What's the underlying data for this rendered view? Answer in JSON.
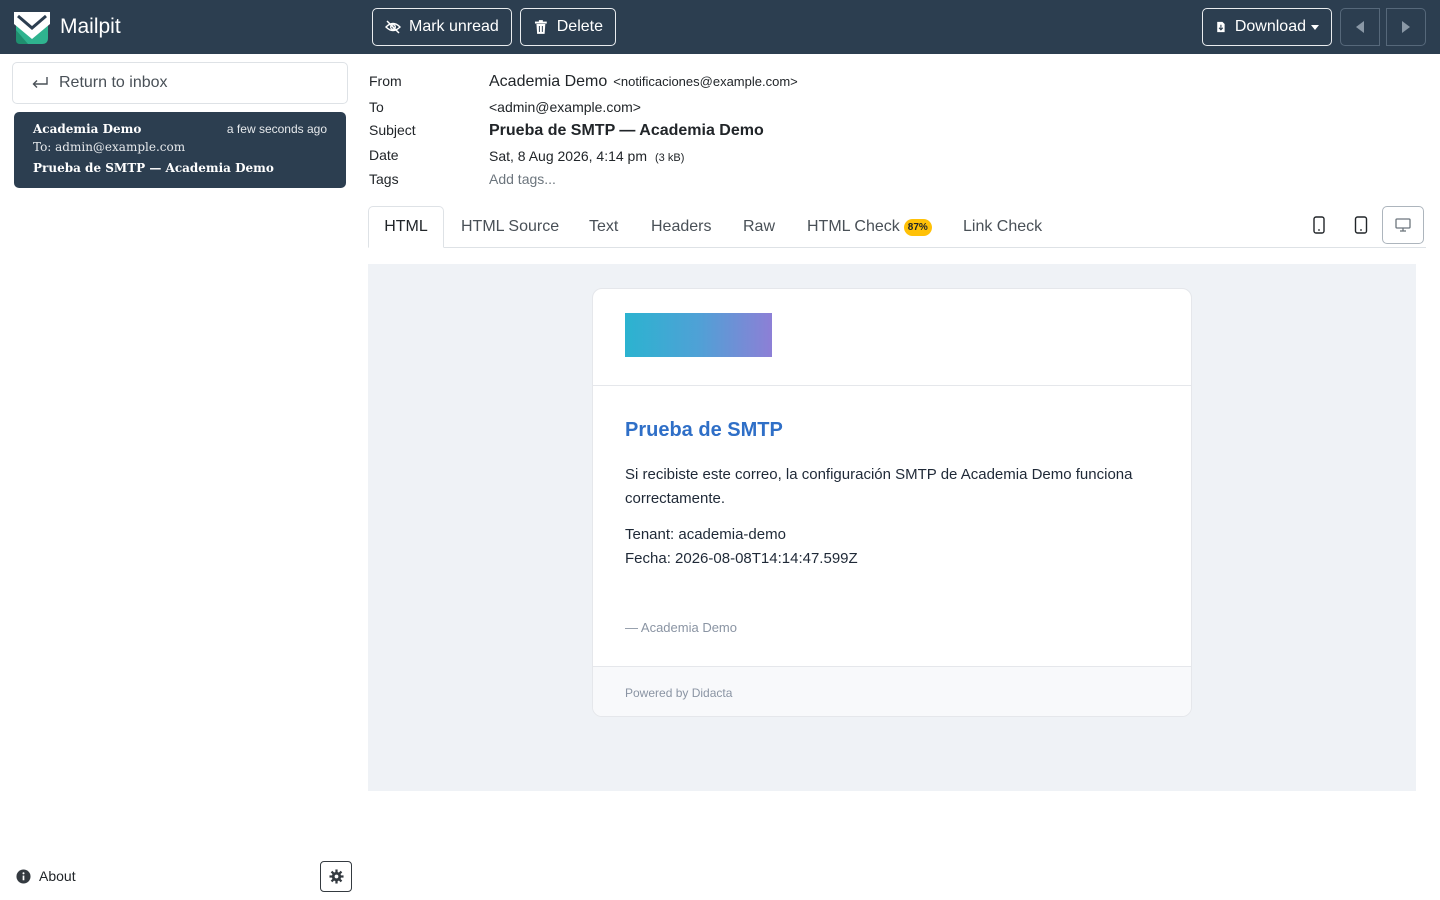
{
  "app": {
    "name": "Mailpit"
  },
  "toolbar": {
    "mark_unread": "Mark unread",
    "delete": "Delete",
    "download": "Download"
  },
  "sidebar": {
    "return_label": "Return to inbox",
    "messages": [
      {
        "from": "Academia Demo",
        "time": "a few seconds ago",
        "to": "To: admin@example.com",
        "subject": "Prueba de SMTP — Academia Demo"
      }
    ],
    "about": "About"
  },
  "headers": {
    "labels": {
      "from": "From",
      "to": "To",
      "subject": "Subject",
      "date": "Date",
      "tags": "Tags"
    },
    "from_name": "Academia Demo",
    "from_email": "<notificaciones@example.com>",
    "to": "<admin@example.com>",
    "subject": "Prueba de SMTP — Academia Demo",
    "date": "Sat, 8 Aug 2026, 4:14 pm",
    "size": "(3 kB)",
    "tags_placeholder": "Add tags..."
  },
  "tabs": {
    "html": "HTML",
    "html_source": "HTML Source",
    "text": "Text",
    "headers": "Headers",
    "raw": "Raw",
    "html_check": "HTML Check",
    "html_check_score": "87%",
    "link_check": "Link Check"
  },
  "email": {
    "title": "Prueba de SMTP",
    "paragraph": "Si recibiste este correo, la configuración SMTP de Academia Demo funciona correctamente.",
    "tenant": "Tenant: academia-demo",
    "fecha": "Fecha: 2026-08-08T14:14:47.599Z",
    "signature": "— Academia Demo",
    "footer": "Powered by Didacta"
  },
  "colors": {
    "topbar": "#2c3e50",
    "accent_title": "#2f6fc7",
    "badge": "#ffc107",
    "preview_bg": "#eff2f6"
  }
}
